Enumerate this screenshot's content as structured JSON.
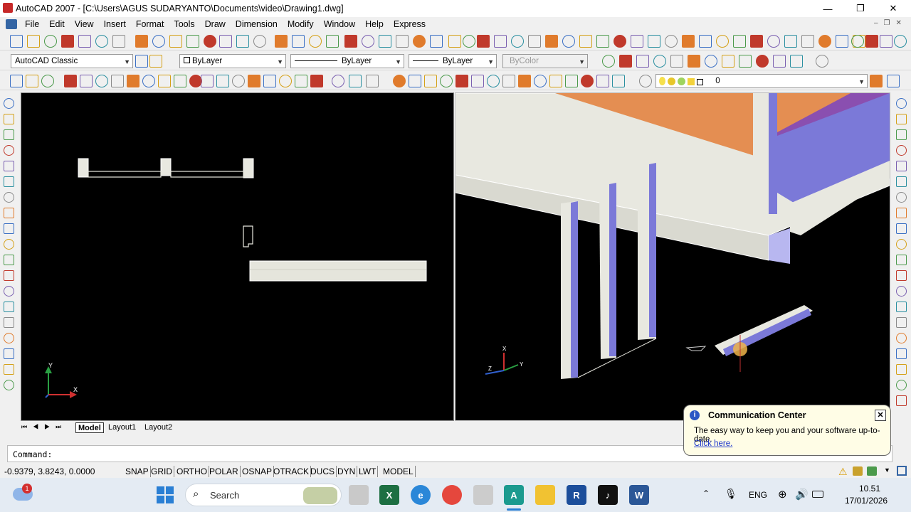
{
  "window": {
    "title": "AutoCAD 2007 - [C:\\Users\\AGUS SUDARYANTO\\Documents\\video\\Drawing1.dwg]",
    "controls": {
      "minimize": "—",
      "restore": "❐",
      "close": "✕"
    }
  },
  "menubar": {
    "items": [
      "File",
      "Edit",
      "View",
      "Insert",
      "Format",
      "Tools",
      "Draw",
      "Dimension",
      "Modify",
      "Window",
      "Help",
      "Express"
    ]
  },
  "properties_toolbar": {
    "workspace": "AutoCAD Classic",
    "color": "ByLayer",
    "linetype": "ByLayer",
    "lineweight": "ByLayer",
    "plotstyle": "ByColor",
    "layer": "0"
  },
  "layout_tabs": {
    "model": "Model",
    "layout1": "Layout1",
    "layout2": "Layout2"
  },
  "command": {
    "prompt": "Command:"
  },
  "status": {
    "coordinates": "-0.9379, 3.8243, 0.0000",
    "toggles": [
      "SNAP",
      "GRID",
      "ORTHO",
      "POLAR",
      "OSNAP",
      "OTRACK",
      "DUCS",
      "DYN",
      "LWT",
      "MODEL"
    ]
  },
  "notification": {
    "title": "Communication Center",
    "body": "The easy way to keep you and your software up-to-date.",
    "link": "Click here."
  },
  "taskbar": {
    "search_placeholder": "Search",
    "weather_badge": "1",
    "language": "ENG",
    "time": "10.51",
    "date": "17/01/2026"
  },
  "ucs": {
    "x": "X",
    "y": "Y",
    "z": "Z"
  },
  "colors": {
    "viewport_bg": "#000000",
    "beam_light": "#e8e8e0",
    "beam_orange": "#e4894a",
    "beam_purple": "#8a4fb0",
    "beam_blue": "#7b79d8",
    "taskbar": "#e4ebf3",
    "notification_bg": "#fffde6"
  },
  "icons": [
    "windows-start-icon",
    "search-icon",
    "excel-icon",
    "edge-icon",
    "chrome-icon",
    "autocad-icon",
    "file-explorer-icon",
    "r-icon",
    "tiktok-icon",
    "word-icon",
    "info-icon",
    "close-icon"
  ]
}
